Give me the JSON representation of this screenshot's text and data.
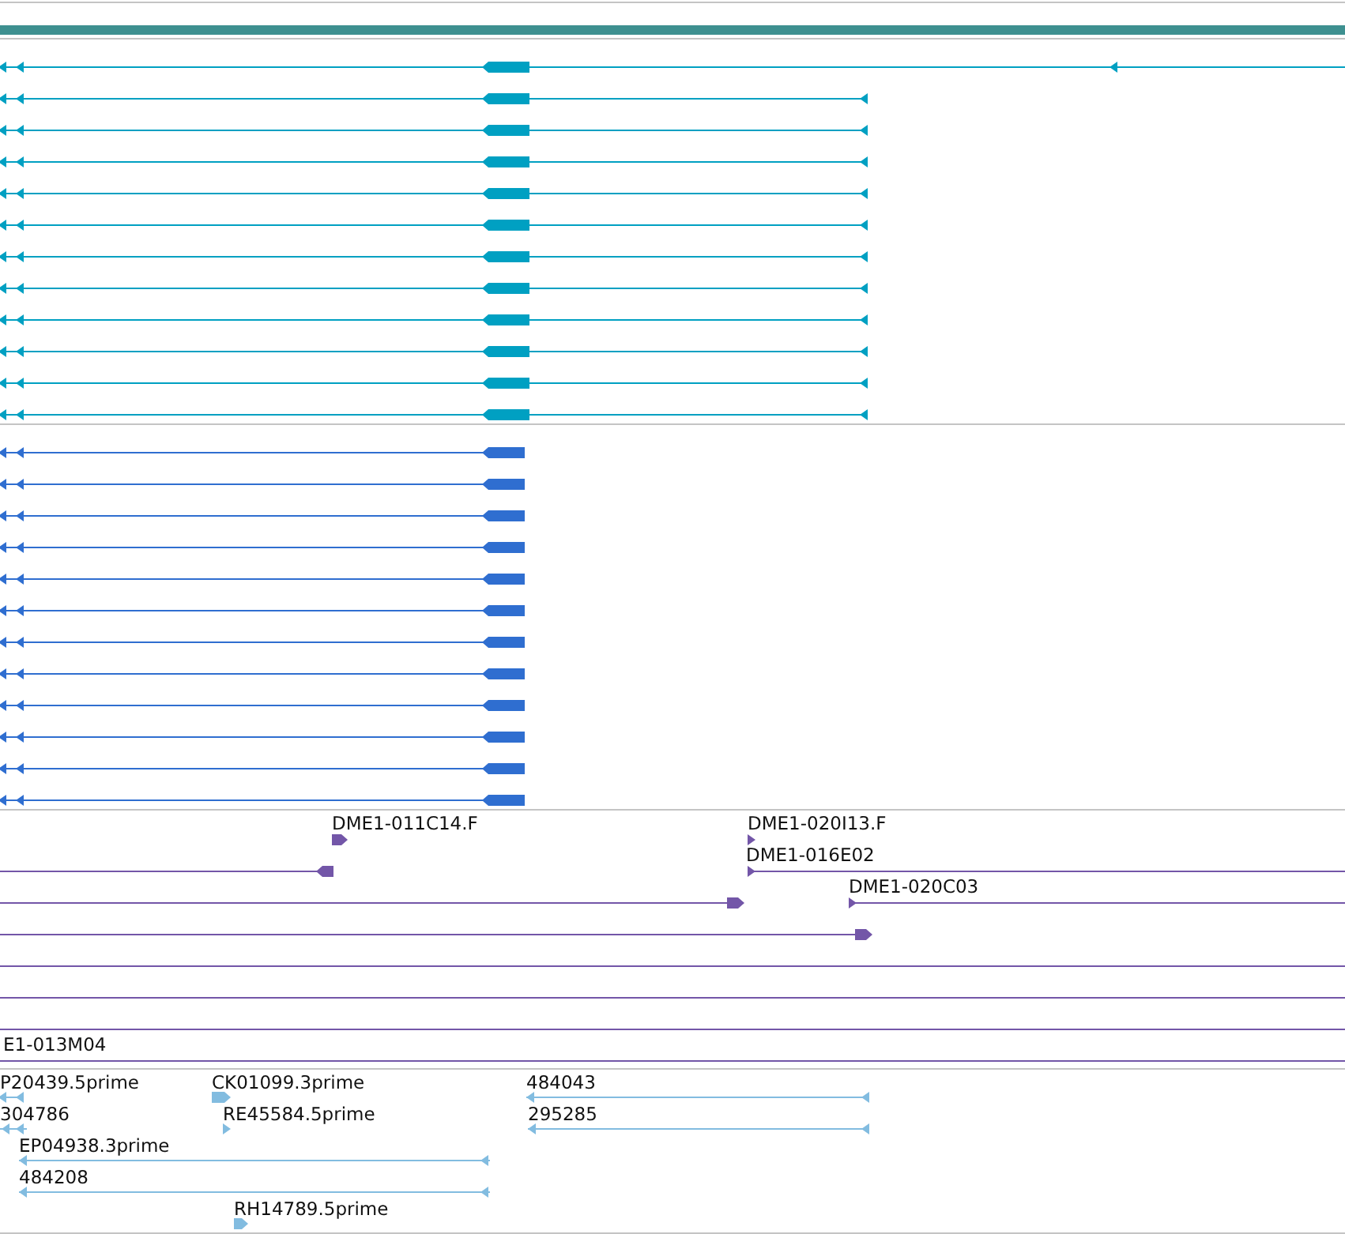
{
  "tracks": [
    {
      "kind": "coverage",
      "color": "#3e9090"
    },
    {
      "kind": "transcripts",
      "color": "#00a0c2",
      "features": [
        {
          "kind": "extended"
        },
        {
          "kind": "standard"
        },
        {
          "kind": "standard"
        },
        {
          "kind": "standard"
        },
        {
          "kind": "standard"
        },
        {
          "kind": "standard"
        },
        {
          "kind": "standard"
        },
        {
          "kind": "standard"
        },
        {
          "kind": "standard"
        },
        {
          "kind": "standard"
        },
        {
          "kind": "standard"
        },
        {
          "kind": "standard"
        }
      ]
    },
    {
      "kind": "transcripts",
      "color": "#2f6ed0",
      "features": [
        {
          "kind": "short"
        },
        {
          "kind": "short"
        },
        {
          "kind": "short"
        },
        {
          "kind": "short"
        },
        {
          "kind": "short"
        },
        {
          "kind": "short"
        },
        {
          "kind": "short"
        },
        {
          "kind": "short"
        },
        {
          "kind": "short"
        },
        {
          "kind": "short"
        },
        {
          "kind": "short"
        },
        {
          "kind": "short"
        }
      ]
    },
    {
      "kind": "alignments",
      "color": "#7356a8",
      "features": [
        {
          "kind": "alignment",
          "label": "DME1-011C14.F"
        },
        {
          "kind": "alignment",
          "label": "DME1-020I13.F"
        },
        {
          "kind": "alignment"
        },
        {
          "kind": "alignment",
          "label": "DME1-016E02"
        },
        {
          "kind": "alignment"
        },
        {
          "kind": "alignment",
          "label": "DME1-020C03"
        },
        {
          "kind": "alignment"
        },
        {
          "kind": "alignment"
        },
        {
          "kind": "alignment"
        },
        {
          "kind": "alignment"
        },
        {
          "kind": "alignment",
          "label": "E1-013M04"
        }
      ]
    },
    {
      "kind": "alignments",
      "color": "#82bce0",
      "features": [
        {
          "kind": "alignment",
          "label": "P20439.5prime"
        },
        {
          "kind": "alignment",
          "label": "CK01099.3prime"
        },
        {
          "kind": "alignment",
          "label": "484043"
        },
        {
          "kind": "alignment",
          "label": "304786"
        },
        {
          "kind": "alignment",
          "label": "RE45584.5prime"
        },
        {
          "kind": "alignment",
          "label": "295285"
        },
        {
          "kind": "alignment",
          "label": "EP04938.3prime"
        },
        {
          "kind": "alignment",
          "label": "484208"
        },
        {
          "kind": "alignment",
          "label": "RH14789.5prime"
        }
      ]
    }
  ]
}
